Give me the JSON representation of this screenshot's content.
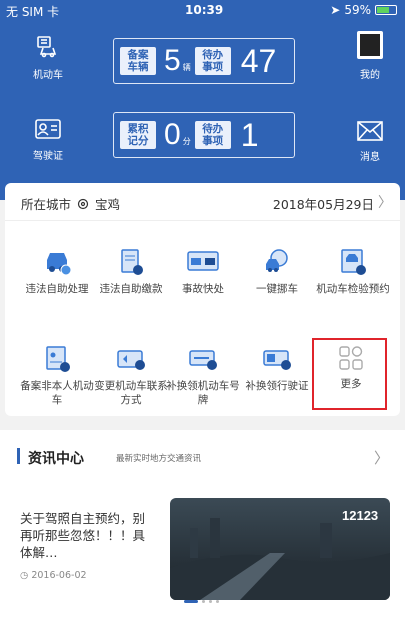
{
  "status_bar": {
    "carrier": "无 SIM 卡",
    "time": "10:39",
    "battery": "59%"
  },
  "header": {
    "vehicle_label": "机动车",
    "license_label": "驾驶证",
    "mine_label": "我的",
    "message_label": "消息",
    "vehicle_counter": {
      "tag": "备案车辆",
      "count": "5",
      "unit": "辆",
      "pending_tag": "待办事项",
      "pending": "47"
    },
    "license_counter": {
      "tag": "累积记分",
      "count": "0",
      "unit": "分",
      "pending_tag": "待办事项",
      "pending": "1"
    }
  },
  "city_row": {
    "label": "所在城市",
    "city": "宝鸡",
    "date": "2018年05月29日"
  },
  "services": [
    {
      "label": "违法自助处理",
      "icon": "car-icon"
    },
    {
      "label": "违法自助缴款",
      "icon": "ticket-icon"
    },
    {
      "label": "事故快处",
      "icon": "accident-icon"
    },
    {
      "label": "一键挪车",
      "icon": "move-car-icon"
    },
    {
      "label": "机动车检验预约",
      "icon": "inspection-icon"
    },
    {
      "label": "备案非本人机动车",
      "icon": "document-icon"
    },
    {
      "label": "变更机动车联系方式",
      "icon": "contact-icon"
    },
    {
      "label": "补换领机动车号牌",
      "icon": "plate-icon"
    },
    {
      "label": "补换领行驶证",
      "icon": "license-card-icon"
    },
    {
      "label": "更多",
      "icon": "more-icon"
    }
  ],
  "news": {
    "title": "资讯中心",
    "subtitle": "最新实时地方交通资讯",
    "article_title": "关于驾照自主预约，别再听那些忽悠！！！具体解…",
    "article_date": "2016-06-02",
    "thumb_text": "12123"
  },
  "colors": {
    "primary": "#2f63b5",
    "highlight": "#e0242b"
  }
}
